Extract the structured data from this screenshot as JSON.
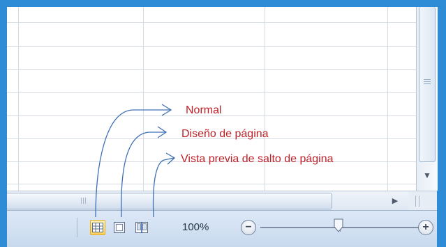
{
  "statusbar": {
    "zoom_label": "100%",
    "zoom_out_label": "−",
    "zoom_in_label": "+",
    "zoom_value_percent": 100,
    "views": [
      {
        "name": "normal-view",
        "active": true
      },
      {
        "name": "page-layout-view",
        "active": false
      },
      {
        "name": "page-break-preview-view",
        "active": false
      }
    ]
  },
  "annotations": {
    "normal": "Normal",
    "page_layout": "Diseño de página",
    "page_break_preview": "Vista previa de salto de página"
  },
  "colors": {
    "frame_blue": "#2e8bd6",
    "callout_red": "#c0202a",
    "arrow_blue": "#3d6fb4",
    "active_view": "#ffd25a"
  },
  "icons": {
    "scroll_down": "▼",
    "scroll_right": "▶"
  }
}
